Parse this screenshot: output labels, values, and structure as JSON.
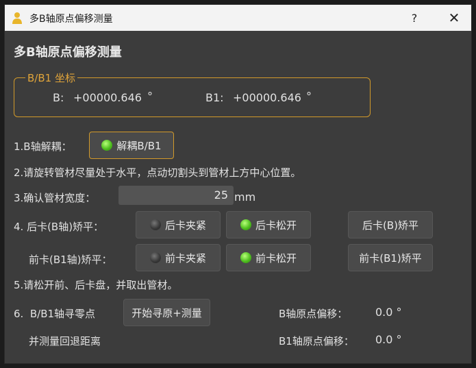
{
  "window": {
    "title": "多B轴原点偏移测量",
    "help_label": "?",
    "close_label": "✕",
    "icon": "user-icon"
  },
  "heading": "多B轴原点偏移测量",
  "coords": {
    "group_title": "B/B1 坐标",
    "b_label": "B:",
    "b_value": "+00000.646",
    "b_unit": "°",
    "b1_label": "B1:",
    "b1_value": "+00000.646",
    "b1_unit": "°"
  },
  "step1": {
    "label": "1.B轴解耦：",
    "button": "解耦B/B1",
    "led": "green"
  },
  "step2": {
    "text": "2.请旋转管材尽量处于水平，点动切割头到管材上方中心位置。"
  },
  "step3": {
    "label": "3.确认管材宽度：",
    "value": "25",
    "unit": "mm"
  },
  "step4": {
    "rear_label": "4. 后卡(B轴)矫平：",
    "rear_clamp": "后卡夹紧",
    "rear_release": "后卡松开",
    "rear_level": "后卡(B)矫平",
    "front_label": "前卡(B1轴)矫平：",
    "front_clamp": "前卡夹紧",
    "front_release": "前卡松开",
    "front_level": "前卡(B1)矫平"
  },
  "step5": {
    "text": "5.请松开前、后卡盘，并取出管材。"
  },
  "step6": {
    "label_line1": "6.  B/B1轴寻零点",
    "label_line2": "并测量回退距离",
    "button": "开始寻原+测量",
    "b_offset_label": "B轴原点偏移：",
    "b_offset_value": "0.0 °",
    "b1_offset_label": "B1轴原点偏移：",
    "b1_offset_value": "0.0 °"
  },
  "colors": {
    "accent": "#d39a2a",
    "led_on": "#4fbf1f",
    "led_off": "#3a3a3a"
  }
}
